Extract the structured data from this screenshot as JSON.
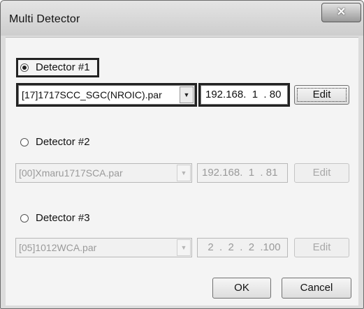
{
  "window": {
    "title": "Multi Detector",
    "close_glyph": "✕"
  },
  "detectors": [
    {
      "label": "Detector #1",
      "selected": true,
      "profile": "[17]1717SCC_SGC(NROIC).par",
      "ip": "192.168.  1  . 80",
      "edit_label": "Edit",
      "enabled": true
    },
    {
      "label": "Detector #2",
      "selected": false,
      "profile": "[00]Xmaru1717SCA.par",
      "ip": "192.168.  1  . 81",
      "edit_label": "Edit",
      "enabled": false
    },
    {
      "label": "Detector #3",
      "selected": false,
      "profile": "[05]1012WCA.par",
      "ip": "  2  .  2  .  2  .100",
      "edit_label": "Edit",
      "enabled": false
    }
  ],
  "footer": {
    "ok_label": "OK",
    "cancel_label": "Cancel"
  },
  "icons": {
    "close": "close-icon",
    "dropdown": "chevron-down-icon"
  }
}
